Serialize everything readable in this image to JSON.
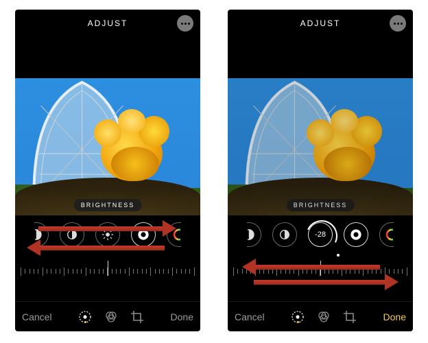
{
  "header": {
    "title": "ADJUST"
  },
  "param_label": "BRIGHTNESS",
  "left": {
    "readout": null,
    "done_active": false
  },
  "right": {
    "readout": "-28",
    "done_active": true
  },
  "buttons": {
    "cancel": "Cancel",
    "done": "Done"
  },
  "control_icons": {
    "exposure": "exposure-icon",
    "contrast": "contrast-icon",
    "brightness": "brightness-icon",
    "blackpoint": "blackpoint-icon",
    "saturation": "saturation-icon"
  },
  "tools": {
    "adjust": "adjust-tool",
    "filters": "filters-tool",
    "crop": "crop-tool"
  }
}
